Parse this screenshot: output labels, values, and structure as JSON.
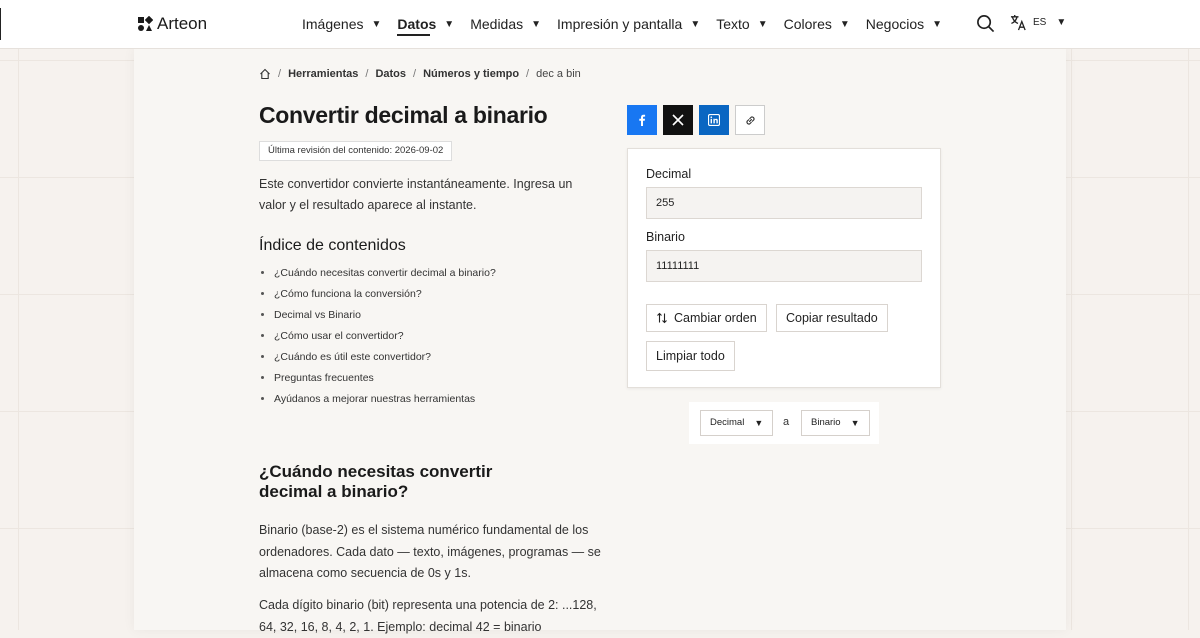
{
  "brand": {
    "name": "Arteon"
  },
  "nav": {
    "items": [
      {
        "label": "Imágenes"
      },
      {
        "label": "Datos"
      },
      {
        "label": "Medidas"
      },
      {
        "label": "Impresión y pantalla"
      },
      {
        "label": "Texto"
      },
      {
        "label": "Colores"
      },
      {
        "label": "Negocios"
      }
    ],
    "active": "Datos"
  },
  "lang": {
    "code": "ES"
  },
  "breadcrumb": [
    "Herramientas",
    "Datos",
    "Números y tiempo",
    "dec a bin"
  ],
  "page": {
    "title": "Convertir decimal a binario",
    "revision": "Última revisión del contenido: 2026-09-02",
    "intro": "Este convertidor convierte instantáneamente. Ingresa un valor y el resultado aparece al instante."
  },
  "toc": {
    "title": "Índice de contenidos",
    "items": [
      "¿Cuándo necesitas convertir decimal a binario?",
      "¿Cómo funciona la conversión?",
      "Decimal vs Binario",
      "¿Cómo usar el convertidor?",
      "¿Cuándo es útil este convertidor?",
      "Preguntas frecuentes",
      "Ayúdanos a mejorar nuestras herramientas"
    ]
  },
  "section": {
    "title": "¿Cuándo necesitas convertir decimal a binario?",
    "p1": "Binario (base-2) es el sistema numérico fundamental de los ordenadores. Cada dato — texto, imágenes, programas — se almacena como secuencia de 0s y 1s.",
    "p2": "Cada dígito binario (bit) representa una potencia de 2: ...128, 64, 32, 16, 8, 4, 2, 1. Ejemplo: decimal 42 = binario"
  },
  "converter": {
    "decimal_label": "Decimal",
    "decimal_value": "255",
    "binary_label": "Binario",
    "binary_value": "11111111",
    "swap_label": "Cambiar orden",
    "copy_label": "Copiar resultado",
    "clear_label": "Limpiar todo",
    "from_unit": "Decimal",
    "to_word": "a",
    "to_unit": "Binario"
  },
  "colors": {
    "facebook": "#1877f2",
    "x": "#111111",
    "linkedin": "#0a66c2"
  },
  "icons": [
    "home-icon",
    "search-icon",
    "translate-icon",
    "facebook-icon",
    "x-icon",
    "linkedin-icon",
    "link-icon",
    "swap-icon"
  ]
}
